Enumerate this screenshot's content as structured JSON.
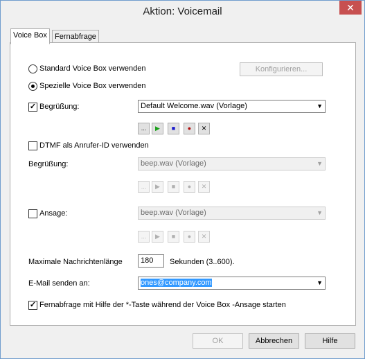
{
  "window": {
    "title": "Aktion: Voicemail",
    "close_label": "✕"
  },
  "tabs": [
    {
      "label": "Voice Box"
    },
    {
      "label": "Fernabfrage"
    }
  ],
  "mode": {
    "standard_label": "Standard  Voice Box  verwenden",
    "special_label": "Spezielle  Voice Box  verwenden",
    "configure_label": "Konfigurieren..."
  },
  "greeting": {
    "label": "Begrüßung:",
    "value": "Default Welcome.wav (Vorlage)",
    "checked": true
  },
  "dtmf": {
    "label": "DTMF als Anrufer-ID verwenden",
    "checked": false
  },
  "greeting2": {
    "label": "Begrüßung:",
    "value": "beep.wav (Vorlage)"
  },
  "announcement": {
    "label": "Ansage:",
    "value": "beep.wav (Vorlage)",
    "checked": false
  },
  "max_length": {
    "label": "Maximale Nachrichtenlänge",
    "value": "180",
    "unit": "Sekunden (3..600)."
  },
  "email": {
    "label": "E-Mail senden an:",
    "value": "ones@company.com"
  },
  "remote": {
    "label": "Fernabfrage mit Hilfe der *-Taste während der Voice Box -Ansage starten",
    "checked": true
  },
  "controls": {
    "browse": "...",
    "play": "▶",
    "stop": "■",
    "record": "●",
    "delete": "✕"
  },
  "footer": {
    "ok": "OK",
    "cancel": "Abbrechen",
    "help": "Hilfe"
  },
  "colors": {
    "play": "#1aa01a",
    "stop": "#1a1acc",
    "record": "#b01010",
    "accent": "#3399ff"
  }
}
